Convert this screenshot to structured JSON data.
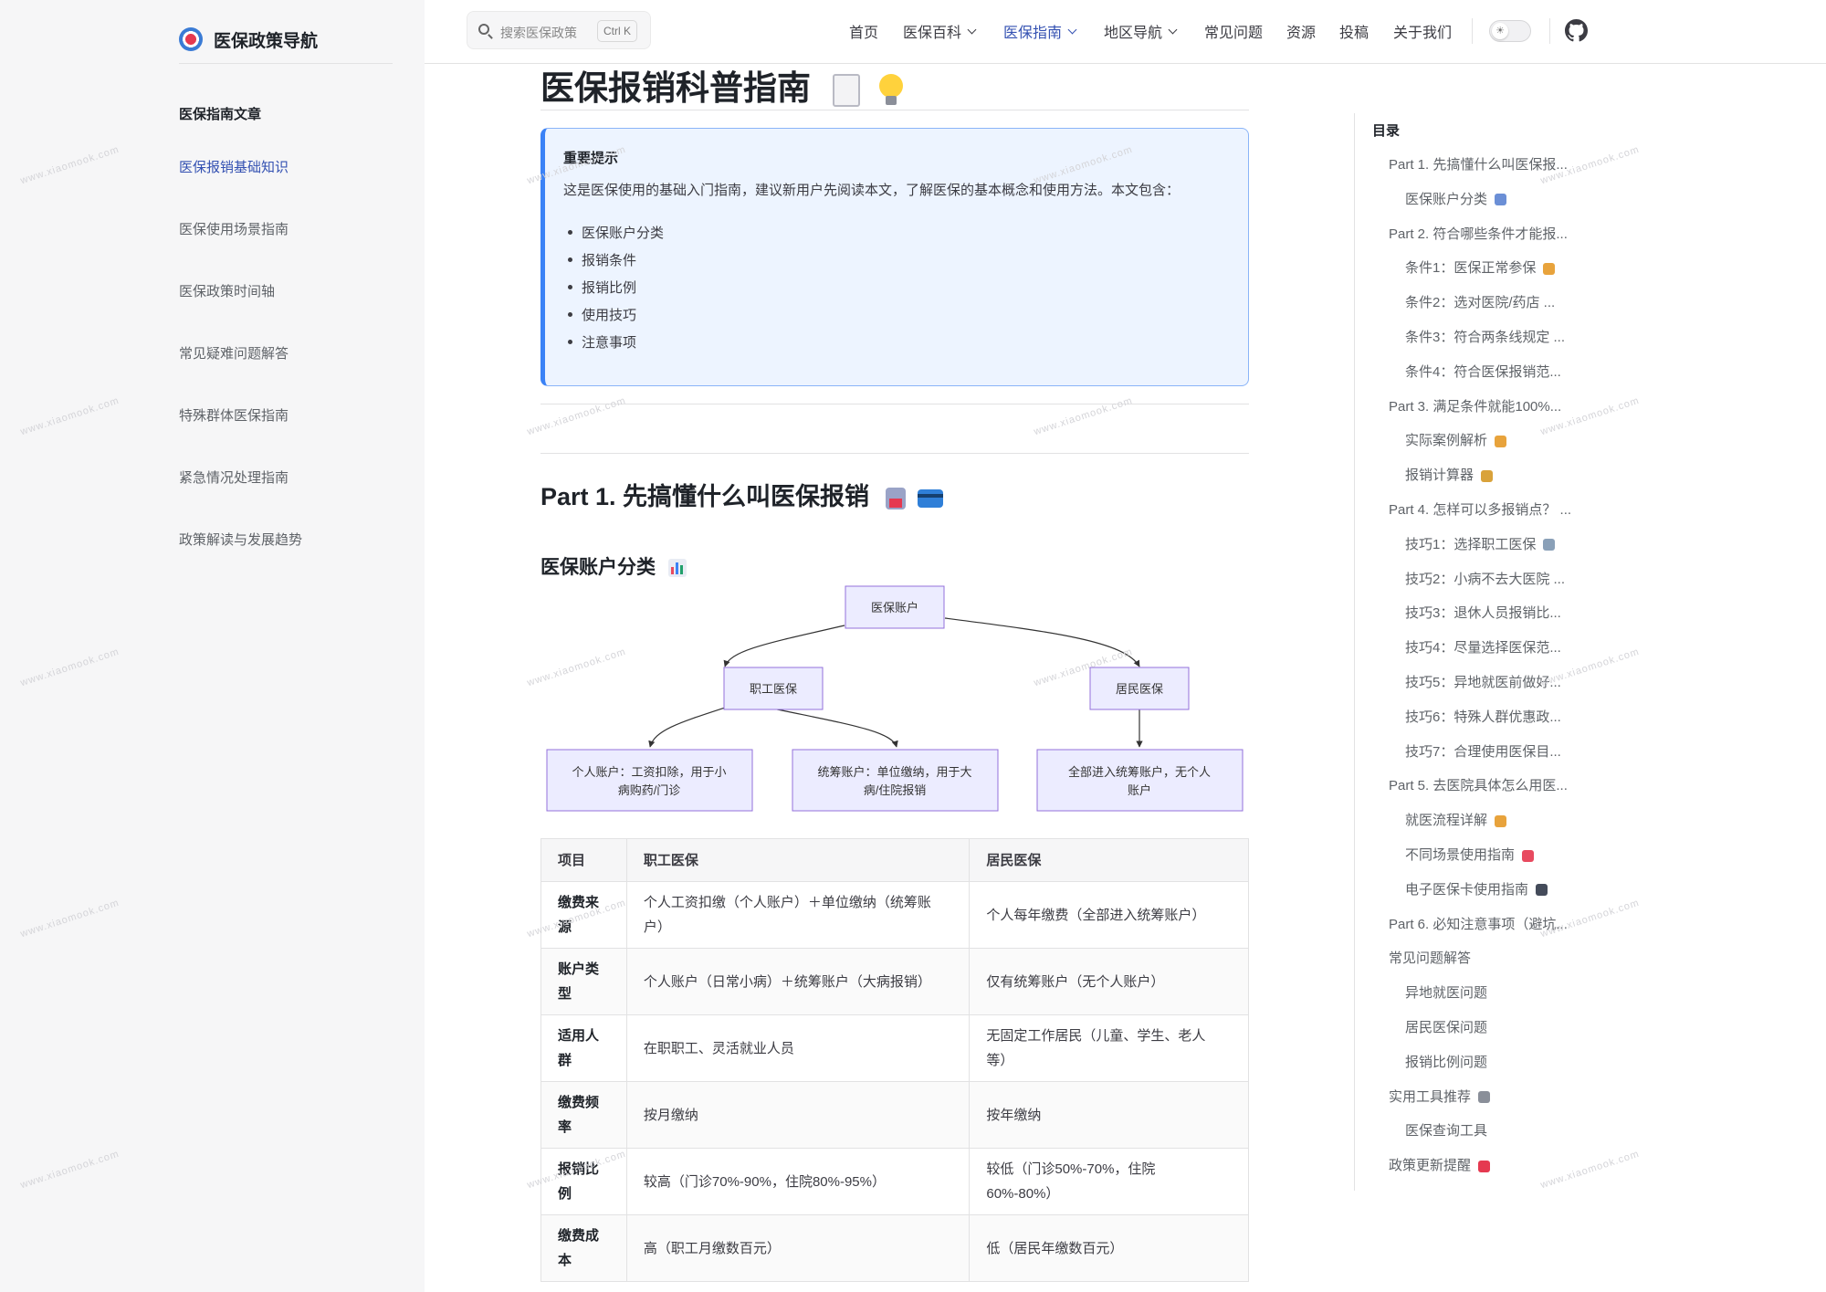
{
  "brand": {
    "title": "医保政策导航",
    "logo_icon": "heart-shield-logo"
  },
  "sidebar": {
    "heading": "医保指南文章",
    "items": [
      {
        "label": "医保报销基础知识",
        "active": true
      },
      {
        "label": "医保使用场景指南",
        "active": false
      },
      {
        "label": "医保政策时间轴",
        "active": false
      },
      {
        "label": "常见疑难问题解答",
        "active": false
      },
      {
        "label": "特殊群体医保指南",
        "active": false
      },
      {
        "label": "紧急情况处理指南",
        "active": false
      },
      {
        "label": "政策解读与发展趋势",
        "active": false
      }
    ]
  },
  "search": {
    "placeholder": "搜索医保政策",
    "shortcut": "Ctrl K"
  },
  "nav": {
    "items": [
      {
        "label": "首页",
        "dropdown": false,
        "active": false
      },
      {
        "label": "医保百科",
        "dropdown": true,
        "active": false
      },
      {
        "label": "医保指南",
        "dropdown": true,
        "active": true
      },
      {
        "label": "地区导航",
        "dropdown": true,
        "active": false
      },
      {
        "label": "常见问题",
        "dropdown": false,
        "active": false
      },
      {
        "label": "资源",
        "dropdown": false,
        "active": false
      },
      {
        "label": "投稿",
        "dropdown": false,
        "active": false
      },
      {
        "label": "关于我们",
        "dropdown": false,
        "active": false
      }
    ],
    "accent": "#3451b2"
  },
  "article": {
    "title": "医保报销科普指南",
    "tip": {
      "title": "重要提示",
      "intro": "这是医保使用的基础入门指南，建议新用户先阅读本文，了解医保的基本概念和使用方法。本文包含：",
      "items": [
        "医保账户分类",
        "报销条件",
        "报销比例",
        "使用技巧",
        "注意事项"
      ]
    },
    "part1_title": "Part 1. 先搞懂什么叫医保报销",
    "section_title": "医保账户分类",
    "diagram": {
      "root": "医保账户",
      "level1": [
        "职工医保",
        "居民医保"
      ],
      "leaf1": [
        "个人账户：工资扣除，用于小",
        "病购药/门诊"
      ],
      "leaf2": [
        "统筹账户：单位缴纳，用于大",
        "病/住院报销"
      ],
      "leaf3": [
        "全部进入统筹账户，无个人",
        "账户"
      ]
    },
    "table": {
      "headers": [
        "项目",
        "职工医保",
        "居民医保"
      ],
      "rows": [
        {
          "item": [
            "缴费来",
            "源"
          ],
          "staff": [
            "个人工资扣缴（个人账户）＋单位缴纳（统筹账",
            "户）"
          ],
          "resident": [
            "个人每年缴费（全部进入统筹账户）"
          ]
        },
        {
          "item": [
            "账户类",
            "型"
          ],
          "staff": [
            "个人账户（日常小病）＋统筹账户（大病报销）"
          ],
          "resident": [
            "仅有统筹账户（无个人账户）"
          ]
        },
        {
          "item": [
            "适用人",
            "群"
          ],
          "staff": [
            "在职职工、灵活就业人员"
          ],
          "resident": [
            "无固定工作居民（儿童、学生、老人",
            "等）"
          ]
        },
        {
          "item": [
            "缴费频",
            "率"
          ],
          "staff": [
            "按月缴纳"
          ],
          "resident": [
            "按年缴纳"
          ]
        },
        {
          "item": [
            "报销比",
            "例"
          ],
          "staff": [
            "较高（门诊70%-90%，住院80%-95%）"
          ],
          "resident": [
            "较低（门诊50%-70%，住院",
            "60%-80%）"
          ]
        },
        {
          "item": [
            "缴费成",
            "本"
          ],
          "staff": [
            "高（职工月缴数百元）"
          ],
          "resident": [
            "低（居民年缴数百元）"
          ]
        }
      ]
    }
  },
  "toc": {
    "title": "目录",
    "items": [
      {
        "label": "Part 1. 先搞懂什么叫医保报...",
        "level": 1
      },
      {
        "label": "医保账户分类",
        "level": 2,
        "emoji": "chart-icon"
      },
      {
        "label": "Part 2. 符合哪些条件才能报...",
        "level": 1
      },
      {
        "label": "条件1：医保正常参保",
        "level": 2,
        "emoji": "memo-icon"
      },
      {
        "label": "条件2：选对医院/药店 ...",
        "level": 2
      },
      {
        "label": "条件3：符合两条线规定 ...",
        "level": 2
      },
      {
        "label": "条件4：符合医保报销范...",
        "level": 2
      },
      {
        "label": "Part 3. 满足条件就能100%...",
        "level": 1
      },
      {
        "label": "实际案例解析",
        "level": 2,
        "emoji": "memo-icon"
      },
      {
        "label": "报销计算器",
        "level": 2,
        "emoji": "money-bag-icon"
      },
      {
        "label": "Part 4. 怎样可以多报销点？ ...",
        "level": 1
      },
      {
        "label": "技巧1：选择职工医保",
        "level": 2,
        "emoji": "office-icon"
      },
      {
        "label": "技巧2：小病不去大医院 ...",
        "level": 2
      },
      {
        "label": "技巧3：退休人员报销比...",
        "level": 2
      },
      {
        "label": "技巧4：尽量选择医保范...",
        "level": 2
      },
      {
        "label": "技巧5：异地就医前做好...",
        "level": 2
      },
      {
        "label": "技巧6：特殊人群优惠政...",
        "level": 2
      },
      {
        "label": "技巧7：合理使用医保目...",
        "level": 2
      },
      {
        "label": "Part 5. 去医院具体怎么用医...",
        "level": 1
      },
      {
        "label": "就医流程详解",
        "level": 2,
        "emoji": "memo-icon"
      },
      {
        "label": "不同场景使用指南",
        "level": 2,
        "emoji": "target-icon"
      },
      {
        "label": "电子医保卡使用指南",
        "level": 2,
        "emoji": "phone-icon"
      },
      {
        "label": "Part 6. 必知注意事项（避坑...",
        "level": 1
      },
      {
        "label": "常见问题解答",
        "level": 1
      },
      {
        "label": "异地就医问题",
        "level": 2
      },
      {
        "label": "居民医保问题",
        "level": 2
      },
      {
        "label": "报销比例问题",
        "level": 2
      },
      {
        "label": "实用工具推荐",
        "level": 1,
        "emoji": "tools-icon"
      },
      {
        "label": "医保查询工具",
        "level": 2
      },
      {
        "label": "政策更新提醒",
        "level": 1,
        "emoji": "flag-icon"
      }
    ]
  },
  "watermark": "www.xiaomook.com"
}
